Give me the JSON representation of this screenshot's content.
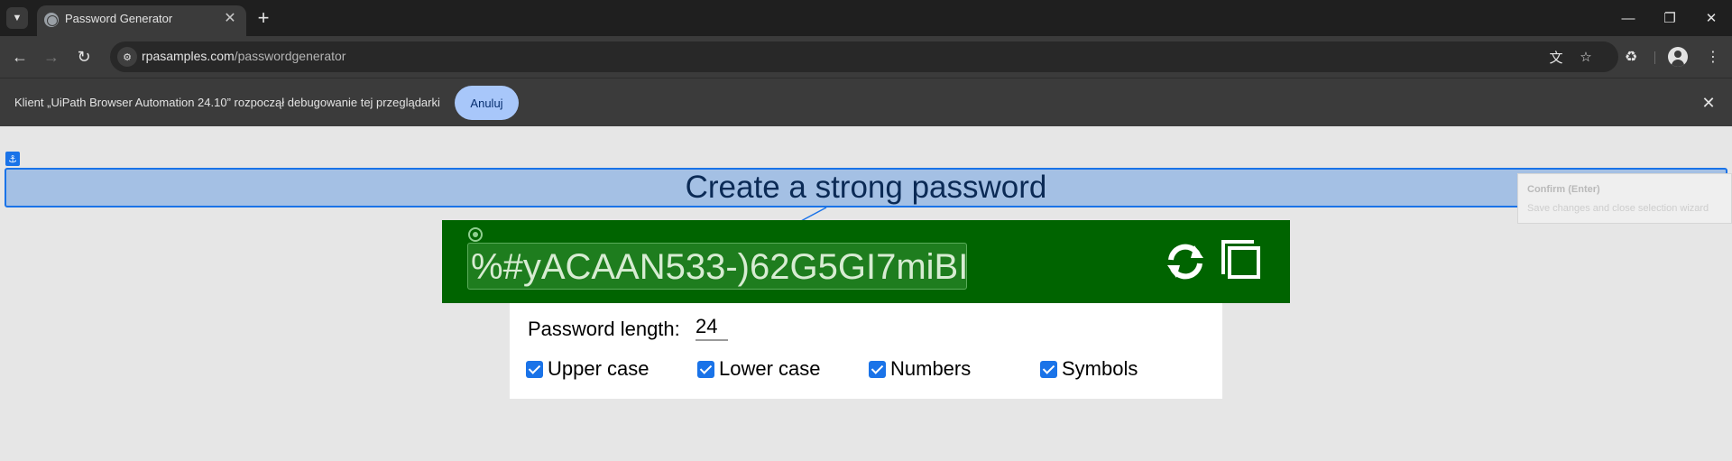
{
  "browser": {
    "tab_title": "Password Generator",
    "url_domain": "rpasamples.com",
    "url_path": "/passwordgenerator",
    "icons": [
      "tab-search-icon",
      "globe-icon",
      "close-icon",
      "plus-icon",
      "minimize-icon",
      "restore-icon",
      "back-icon",
      "forward-icon",
      "reload-icon",
      "site-info-icon",
      "translate-icon",
      "star-icon",
      "extensions-icon",
      "profile-icon",
      "menu-icon"
    ]
  },
  "infobar": {
    "message": "Klient „UiPath Browser Automation 24.10” rozpoczął debugowanie tej przeglądarki",
    "cancel_label": "Anuluj"
  },
  "page": {
    "title": "Create a strong password",
    "password": "%#yACAAN533-)62G5GI7miBI",
    "length_label": "Password length:",
    "length_value": "24",
    "options": [
      {
        "label": "Upper case",
        "checked": true
      },
      {
        "label": "Lower case",
        "checked": true
      },
      {
        "label": "Numbers",
        "checked": true
      },
      {
        "label": "Symbols",
        "checked": true
      }
    ]
  },
  "overlay": {
    "confirm_title": "Confirm (Enter)",
    "confirm_subtitle": "Save changes and close selection wizard"
  },
  "colors": {
    "generator_bg": "#006400",
    "selection_blue": "#1a73e8",
    "cancel_button": "#a8c7fa"
  }
}
